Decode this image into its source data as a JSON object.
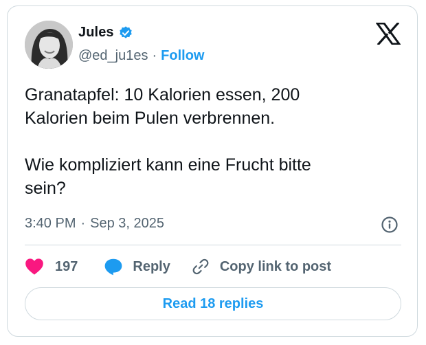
{
  "author": {
    "name": "Jules",
    "handle": "@ed_ju1es",
    "separator": "·",
    "follow_label": "Follow",
    "verified_badge_color": "#1d9bf0"
  },
  "tweet": {
    "text": "Granatapfel: 10 Kalorien essen, 200\nKalorien beim Pulen verbrennen.\n\nWie kompliziert kann eine Frucht bitte\nsein?",
    "time": "3:40 PM",
    "separator": "·",
    "date": "Sep 3, 2025"
  },
  "actions": {
    "like_count": "197",
    "reply_label": "Reply",
    "copy_link_label": "Copy link to post"
  },
  "read_replies_label": "Read 18 replies",
  "colors": {
    "accent": "#1d9bf0",
    "like": "#f91880",
    "reply": "#1d9bf0",
    "muted_text": "#536471",
    "border": "#cfd9de"
  },
  "icons": [
    "verified-badge-icon",
    "x-logo-icon",
    "info-icon",
    "heart-icon",
    "reply-bubble-icon",
    "link-icon"
  ]
}
